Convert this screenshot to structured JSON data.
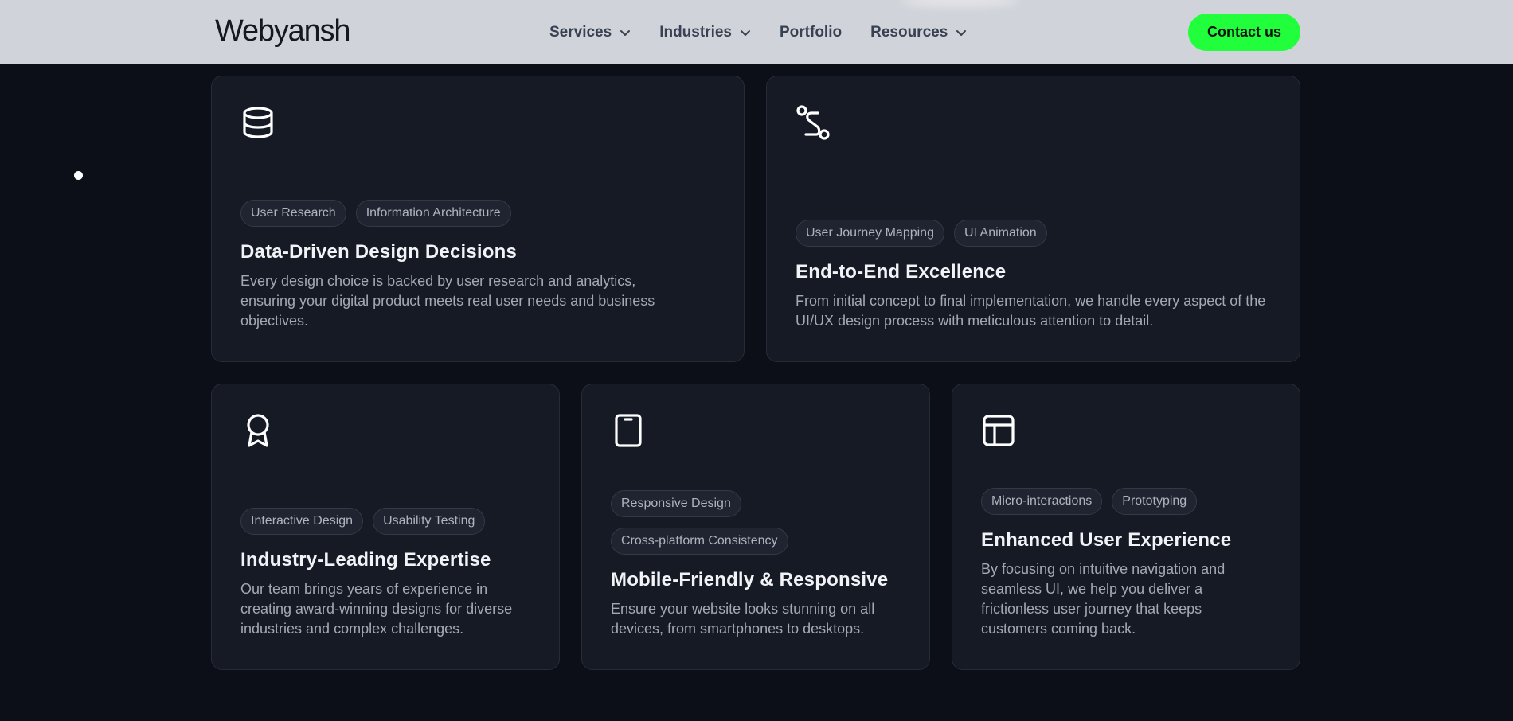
{
  "nav": {
    "logo": "Webyansh",
    "links": [
      {
        "label": "Services",
        "dropdown": true
      },
      {
        "label": "Industries",
        "dropdown": true
      },
      {
        "label": "Portfolio",
        "dropdown": false
      },
      {
        "label": "Resources",
        "dropdown": true
      }
    ],
    "cta": "Contact us"
  },
  "colors": {
    "accent": "#21ff3c",
    "background": "#0c0f18",
    "card": "#161a25",
    "nav_bg": "#d0d3d9"
  },
  "cards": [
    {
      "icon": "database-icon",
      "tags": [
        "User Research",
        "Information Architecture"
      ],
      "title": "Data-Driven Design Decisions",
      "description": "Every design choice is backed by user research and analytics, ensuring your digital product meets real user needs and business objectives."
    },
    {
      "icon": "route-icon",
      "tags": [
        "User Journey Mapping",
        "UI Animation"
      ],
      "title": "End-to-End Excellence",
      "description": "From initial concept to final implementation, we handle every aspect of the UI/UX design process with meticulous attention to detail."
    },
    {
      "icon": "award-icon",
      "tags": [
        "Interactive Design",
        "Usability Testing"
      ],
      "title": "Industry-Leading Expertise",
      "description": "Our team brings years of experience in creating award-winning designs for diverse industries and complex challenges."
    },
    {
      "icon": "tablet-icon",
      "tags": [
        "Responsive Design",
        "Cross-platform Consistency"
      ],
      "title": "Mobile-Friendly & Responsive",
      "description": "Ensure your website looks stunning on all devices, from smartphones to desktops."
    },
    {
      "icon": "layout-icon",
      "tags": [
        "Micro-interactions",
        "Prototyping"
      ],
      "title": "Enhanced User Experience",
      "description": "By focusing on intuitive navigation and seamless UI, we help you deliver a frictionless user journey that keeps customers coming back."
    }
  ]
}
